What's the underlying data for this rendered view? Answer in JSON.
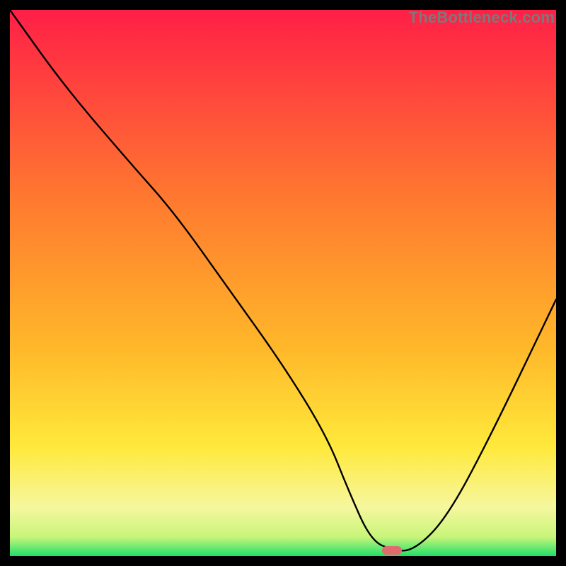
{
  "watermark": "TheBottleneck.com",
  "colors": {
    "gradient_top": "#ff1f47",
    "gradient_mid_orange": "#ff9a2a",
    "gradient_yellow": "#ffe93b",
    "gradient_pale_yellow": "#faf9a8",
    "gradient_bottom_green": "#1fe06a",
    "curve": "#000000",
    "marker": "#e16a6d",
    "frame": "#000000"
  },
  "chart_data": {
    "type": "line",
    "title": "",
    "xlabel": "",
    "ylabel": "",
    "xlim": [
      0,
      100
    ],
    "ylim": [
      0,
      100
    ],
    "series": [
      {
        "name": "bottleneck-curve",
        "x": [
          0,
          10,
          22,
          30,
          40,
          50,
          58,
          62,
          66,
          70,
          74,
          80,
          88,
          100
        ],
        "y": [
          100,
          86,
          72,
          63,
          49,
          35,
          22,
          12,
          3,
          1,
          1,
          7,
          22,
          47
        ]
      }
    ],
    "marker": {
      "x": 70,
      "y": 1
    },
    "background_gradient_stops": [
      {
        "offset": 0.0,
        "color": "#ff1f47"
      },
      {
        "offset": 0.35,
        "color": "#ff7a2f"
      },
      {
        "offset": 0.62,
        "color": "#ffb82a"
      },
      {
        "offset": 0.8,
        "color": "#ffe93b"
      },
      {
        "offset": 0.91,
        "color": "#f6f79e"
      },
      {
        "offset": 0.965,
        "color": "#c8f57a"
      },
      {
        "offset": 1.0,
        "color": "#1fe06a"
      }
    ]
  }
}
